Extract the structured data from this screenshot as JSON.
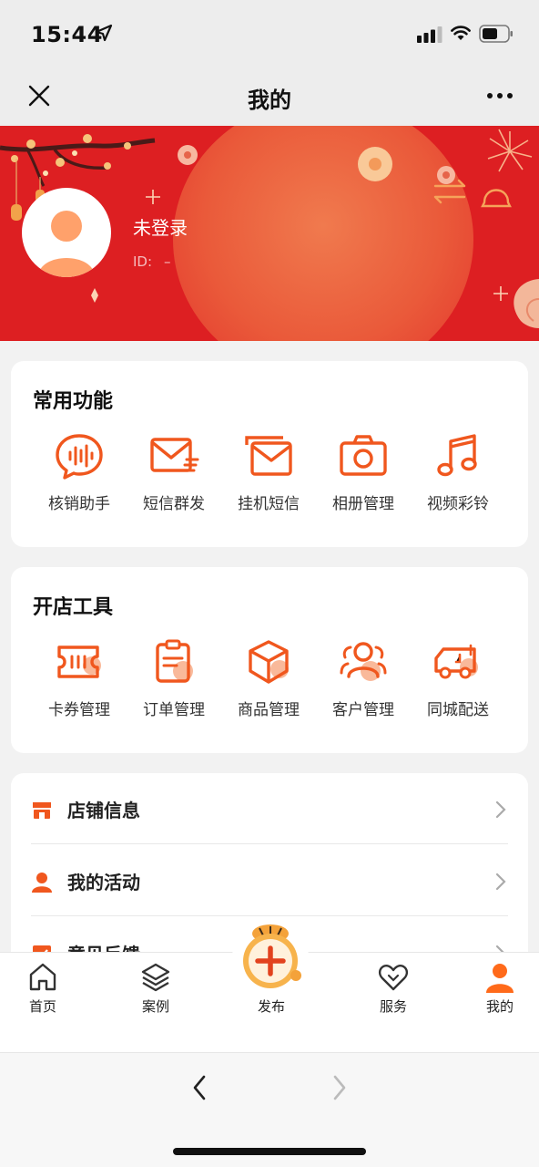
{
  "status_bar": {
    "time": "15:44"
  },
  "title_bar": {
    "title": "我的"
  },
  "profile": {
    "login_status": "未登录",
    "id_label": "ID:",
    "id_value": "–"
  },
  "common_functions": {
    "title": "常用功能",
    "items": [
      {
        "label": "核销助手",
        "icon": "voice-bubble-icon"
      },
      {
        "label": "短信群发",
        "icon": "sms-broadcast-icon"
      },
      {
        "label": "挂机短信",
        "icon": "stacked-mail-icon"
      },
      {
        "label": "相册管理",
        "icon": "camera-icon"
      },
      {
        "label": "视频彩铃",
        "icon": "music-note-icon"
      }
    ]
  },
  "shop_tools": {
    "title": "开店工具",
    "items": [
      {
        "label": "卡券管理",
        "icon": "ticket-icon"
      },
      {
        "label": "订单管理",
        "icon": "order-clipboard-icon"
      },
      {
        "label": "商品管理",
        "icon": "package-box-icon"
      },
      {
        "label": "客户管理",
        "icon": "customers-icon"
      },
      {
        "label": "同城配送",
        "icon": "delivery-truck-icon"
      }
    ]
  },
  "menu_list": [
    {
      "label": "店铺信息",
      "icon": "store-icon"
    },
    {
      "label": "我的活动",
      "icon": "person-icon"
    },
    {
      "label": "意见反馈",
      "icon": "feedback-icon"
    }
  ],
  "tab_bar": [
    {
      "label": "首页",
      "icon": "home-icon"
    },
    {
      "label": "案例",
      "icon": "layers-icon"
    },
    {
      "label": "发布",
      "icon": "publish-plus-icon"
    },
    {
      "label": "服务",
      "icon": "heart-handshake-icon"
    },
    {
      "label": "我的",
      "icon": "profile-icon",
      "active": true
    }
  ],
  "colors": {
    "accent": "#f0571e",
    "banner_red": "#dd1f22",
    "active_tab": "#ff6a1a"
  }
}
